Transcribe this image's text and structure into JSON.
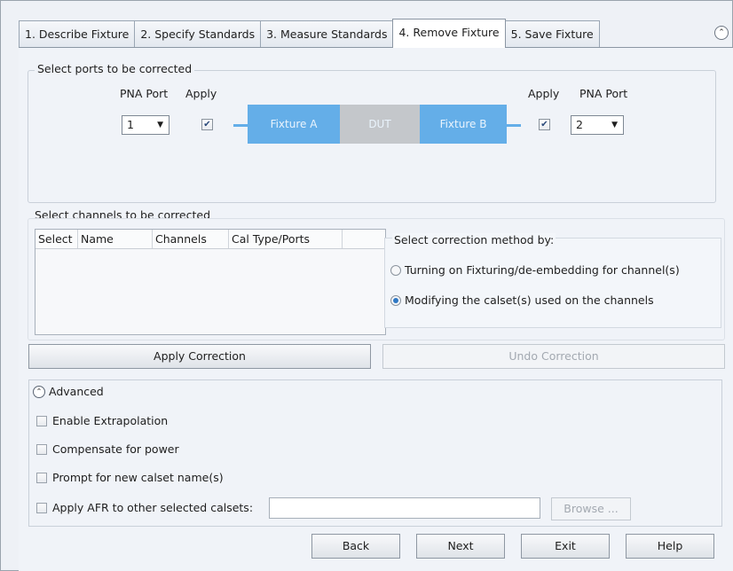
{
  "tabs": [
    {
      "label": "1. Describe Fixture"
    },
    {
      "label": "2. Specify Standards"
    },
    {
      "label": "3. Measure Standards"
    },
    {
      "label": "4. Remove Fixture"
    },
    {
      "label": "5. Save Fixture"
    }
  ],
  "ports": {
    "group_label": "Select ports to be corrected",
    "pna_port_label": "PNA Port",
    "apply_label": "Apply",
    "left_port": "1",
    "right_port": "2",
    "left_apply": "✔",
    "right_apply": "✔",
    "fixture_a": "Fixture A",
    "dut": "DUT",
    "fixture_b": "Fixture B"
  },
  "channels": {
    "group_label": "Select channels to be corrected",
    "columns": [
      "Select",
      "Name",
      "Channels",
      "Cal Type/Ports"
    ]
  },
  "method": {
    "label": "Select correction method by:",
    "option1": "Turning on Fixturing/de-embedding  for channel(s)",
    "option2": "Modifying the calset(s) used on the channels",
    "selected": 2
  },
  "buttons": {
    "apply_correction": "Apply Correction",
    "undo_correction": "Undo Correction",
    "back": "Back",
    "next": "Next",
    "exit": "Exit",
    "help": "Help",
    "browse": "Browse ..."
  },
  "advanced": {
    "label": "Advanced",
    "enable_extrapolation": "Enable Extrapolation",
    "compensate_power": "Compensate for power",
    "prompt_calset": "Prompt for new calset name(s)",
    "apply_afr": "Apply AFR to other selected calsets:",
    "afr_value": ""
  },
  "colors": {
    "fixture_blue": "#64aee8",
    "dut_gray": "#c4c7cb"
  },
  "icons": {
    "collapse_top": "chevron-up-circle-icon",
    "advanced": "chevron-up-circle-icon",
    "dropdown": "caret-down-icon"
  }
}
